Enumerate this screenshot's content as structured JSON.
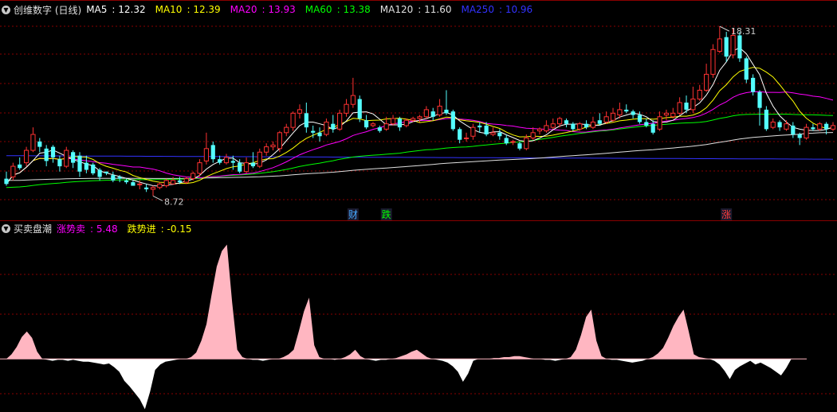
{
  "panel1": {
    "name": "创维数字 (日线)",
    "ma": [
      {
        "label": "MA5",
        "value": "12.32",
        "color": "#ffffff"
      },
      {
        "label": "MA10",
        "value": "12.39",
        "color": "#ffff00"
      },
      {
        "label": "MA20",
        "value": "13.93",
        "color": "#ff00ff"
      },
      {
        "label": "MA60",
        "value": "13.38",
        "color": "#00ff00"
      },
      {
        "label": "MA120",
        "value": "11.60",
        "color": "#e0e0e0"
      },
      {
        "label": "MA250",
        "value": "10.96",
        "color": "#3232ff"
      }
    ],
    "price_high_label": "18.31",
    "price_low_label": "8.72",
    "markers": [
      {
        "text": "财",
        "color": "#46aaff"
      },
      {
        "text": "跌",
        "color": "#00ff00"
      },
      {
        "text": "涨",
        "color": "#ff3c3c"
      }
    ]
  },
  "panel2": {
    "name": "买卖盘潮",
    "series": [
      {
        "label": "涨势卖",
        "value": "5.48",
        "color": "#ff00ff"
      },
      {
        "label": "跌势进",
        "value": "-0.15",
        "color": "#ffff00"
      }
    ]
  },
  "chart_data": {
    "type": "candlestick",
    "ylim": [
      8.2,
      18.9
    ],
    "candles": [
      [
        9.7,
        9.4,
        10.1,
        9.3
      ],
      [
        9.8,
        10.4,
        10.6,
        9.6
      ],
      [
        10.5,
        10.3,
        10.9,
        10.2
      ],
      [
        10.6,
        11.3,
        11.5,
        10.4
      ],
      [
        11.3,
        12.2,
        12.6,
        11.2
      ],
      [
        11.8,
        11.5,
        12.0,
        11.2
      ],
      [
        11.4,
        10.7,
        11.6,
        10.4
      ],
      [
        11.5,
        10.9,
        11.6,
        10.6
      ],
      [
        10.8,
        10.4,
        11.0,
        10.1
      ],
      [
        10.4,
        11.3,
        11.5,
        10.3
      ],
      [
        11.2,
        10.6,
        11.3,
        10.3
      ],
      [
        11.0,
        10.1,
        11.2,
        9.8
      ],
      [
        10.6,
        10.2,
        11.0,
        10.0
      ],
      [
        10.5,
        10.0,
        10.6,
        9.9
      ],
      [
        10.2,
        9.8,
        10.3,
        9.6
      ],
      [
        10.1,
        10.0,
        10.1,
        9.9
      ],
      [
        9.9,
        9.6,
        10.1,
        9.5
      ],
      [
        9.8,
        9.7,
        9.9,
        9.5
      ],
      [
        9.6,
        9.5,
        9.7,
        9.4
      ],
      [
        9.5,
        9.3,
        9.6,
        9.3
      ],
      [
        9.4,
        9.4,
        9.6,
        9.1
      ],
      [
        9.2,
        9.1,
        9.4,
        8.95
      ],
      [
        9.1,
        9.2,
        9.3,
        8.72
      ],
      [
        9.2,
        9.4,
        9.5,
        9.1
      ],
      [
        9.3,
        9.6,
        9.7,
        9.2
      ],
      [
        9.4,
        9.6,
        9.8,
        9.4
      ],
      [
        9.6,
        9.5,
        9.8,
        9.4
      ],
      [
        9.5,
        9.7,
        9.8,
        9.4
      ],
      [
        9.7,
        10.0,
        10.1,
        9.6
      ],
      [
        10.0,
        10.6,
        10.8,
        9.8
      ],
      [
        10.7,
        11.4,
        12.3,
        10.5
      ],
      [
        11.6,
        10.8,
        11.8,
        10.6
      ],
      [
        10.8,
        10.6,
        11.0,
        10.5
      ],
      [
        10.6,
        10.9,
        11.1,
        10.5
      ],
      [
        10.7,
        10.6,
        11.0,
        10.2
      ],
      [
        10.6,
        10.1,
        10.8,
        10.0
      ],
      [
        10.1,
        10.6,
        10.9,
        10.0
      ],
      [
        10.6,
        10.4,
        11.2,
        10.3
      ],
      [
        10.4,
        11.2,
        11.4,
        10.3
      ],
      [
        11.2,
        11.5,
        11.7,
        11.0
      ],
      [
        11.5,
        11.6,
        11.8,
        11.3
      ],
      [
        11.4,
        12.3,
        12.4,
        11.2
      ],
      [
        12.3,
        12.6,
        12.8,
        12.1
      ],
      [
        12.6,
        13.4,
        13.5,
        12.4
      ],
      [
        13.4,
        13.6,
        13.9,
        13.1
      ],
      [
        13.4,
        12.6,
        14.0,
        12.3
      ],
      [
        12.4,
        12.3,
        12.7,
        12.0
      ],
      [
        12.3,
        12.1,
        12.6,
        11.8
      ],
      [
        12.2,
        12.9,
        13.1,
        12.1
      ],
      [
        12.8,
        12.5,
        13.3,
        12.3
      ],
      [
        12.5,
        13.4,
        13.6,
        12.4
      ],
      [
        13.4,
        13.9,
        14.2,
        13.2
      ],
      [
        13.9,
        14.4,
        15.4,
        13.7
      ],
      [
        14.2,
        13.1,
        14.4,
        12.9
      ],
      [
        13.0,
        12.6,
        13.3,
        12.5
      ],
      [
        12.7,
        12.8,
        12.9,
        12.6
      ],
      [
        12.6,
        12.4,
        12.7,
        12.3
      ],
      [
        12.5,
        12.8,
        13.2,
        12.4
      ],
      [
        12.8,
        13.1,
        13.3,
        12.7
      ],
      [
        13.1,
        12.6,
        13.2,
        12.4
      ],
      [
        12.7,
        13.0,
        13.1,
        12.6
      ],
      [
        13.0,
        13.1,
        13.2,
        12.9
      ],
      [
        13.1,
        13.2,
        13.3,
        12.9
      ],
      [
        13.2,
        13.6,
        13.8,
        13.1
      ],
      [
        13.5,
        13.2,
        13.7,
        13.0
      ],
      [
        13.3,
        13.8,
        14.2,
        13.2
      ],
      [
        13.6,
        13.4,
        14.7,
        13.3
      ],
      [
        13.5,
        12.5,
        13.6,
        12.4
      ],
      [
        12.5,
        11.9,
        12.6,
        11.7
      ],
      [
        12.0,
        12.0,
        12.3,
        11.8
      ],
      [
        12.1,
        12.6,
        12.8,
        11.9
      ],
      [
        12.7,
        12.6,
        12.9,
        12.3
      ],
      [
        12.7,
        12.2,
        12.9,
        12.1
      ],
      [
        12.2,
        12.3,
        12.6,
        12.1
      ],
      [
        12.3,
        12.1,
        12.5,
        11.9
      ],
      [
        12.0,
        11.7,
        12.2,
        11.6
      ],
      [
        11.8,
        11.8,
        11.9,
        11.6
      ],
      [
        11.7,
        11.4,
        11.8,
        11.3
      ],
      [
        11.4,
        12.0,
        12.2,
        11.3
      ],
      [
        12.0,
        12.3,
        12.6,
        11.9
      ],
      [
        12.4,
        12.5,
        12.6,
        12.2
      ],
      [
        12.4,
        12.7,
        13.0,
        12.3
      ],
      [
        12.6,
        12.8,
        13.1,
        12.5
      ],
      [
        12.8,
        13.1,
        13.2,
        12.6
      ],
      [
        13.0,
        12.8,
        13.1,
        12.6
      ],
      [
        12.8,
        12.5,
        12.9,
        12.4
      ],
      [
        12.5,
        12.8,
        12.9,
        12.4
      ],
      [
        12.8,
        12.6,
        13.0,
        12.5
      ],
      [
        12.6,
        12.9,
        13.2,
        12.5
      ],
      [
        13.0,
        12.8,
        13.4,
        12.7
      ],
      [
        12.9,
        13.2,
        13.5,
        12.8
      ],
      [
        13.0,
        13.4,
        13.7,
        12.9
      ],
      [
        13.3,
        13.6,
        14.0,
        13.1
      ],
      [
        13.6,
        13.5,
        13.9,
        13.4
      ],
      [
        13.5,
        13.3,
        13.6,
        13.1
      ],
      [
        13.3,
        12.9,
        13.5,
        12.8
      ],
      [
        12.9,
        12.7,
        13.1,
        12.6
      ],
      [
        12.8,
        12.3,
        13.0,
        12.2
      ],
      [
        12.5,
        13.2,
        13.5,
        12.4
      ],
      [
        13.3,
        13.4,
        13.6,
        13.0
      ],
      [
        13.2,
        13.4,
        13.7,
        13.1
      ],
      [
        13.4,
        14.0,
        14.3,
        13.3
      ],
      [
        14.0,
        13.6,
        14.4,
        13.4
      ],
      [
        13.6,
        14.2,
        14.9,
        13.4
      ],
      [
        14.2,
        14.7,
        15.0,
        14.1
      ],
      [
        14.7,
        15.6,
        16.2,
        14.6
      ],
      [
        15.6,
        17.0,
        17.3,
        15.4
      ],
      [
        16.9,
        17.6,
        18.31,
        16.8
      ],
      [
        17.7,
        16.6,
        18.0,
        16.3
      ],
      [
        16.7,
        17.8,
        18.2,
        16.5
      ],
      [
        17.8,
        16.5,
        18.0,
        16.3
      ],
      [
        16.5,
        15.3,
        16.6,
        15.1
      ],
      [
        15.4,
        14.6,
        15.6,
        14.4
      ],
      [
        14.6,
        13.7,
        14.7,
        12.7
      ],
      [
        13.6,
        12.5,
        13.8,
        12.4
      ],
      [
        12.6,
        12.9,
        13.1,
        12.5
      ],
      [
        12.9,
        12.6,
        13.0,
        12.4
      ],
      [
        12.5,
        12.8,
        13.0,
        12.4
      ],
      [
        12.7,
        12.2,
        12.9,
        12.0
      ],
      [
        12.2,
        12.0,
        12.3,
        11.6
      ],
      [
        12.0,
        12.6,
        12.8,
        11.9
      ],
      [
        12.6,
        12.5,
        12.8,
        12.4
      ],
      [
        12.5,
        12.8,
        12.9,
        12.4
      ],
      [
        12.8,
        12.5,
        12.9,
        12.2
      ],
      [
        12.5,
        12.7,
        12.9,
        12.4
      ]
    ],
    "ma250": [
      11.0,
      10.8
    ],
    "ma120_start": 9.6,
    "osc_ylim": [
      -5.8,
      13.5
    ],
    "osc": [
      0,
      0.5,
      1.3,
      2.4,
      3.0,
      2.3,
      0.8,
      0,
      -0.1,
      -0.2,
      -0.1,
      -0.1,
      -0.2,
      -0.1,
      -0.2,
      -0.3,
      -0.3,
      -0.4,
      -0.5,
      -0.6,
      -0.5,
      -0.9,
      -1.4,
      -2.4,
      -3.0,
      -3.7,
      -4.4,
      -5.5,
      -3.6,
      -1.2,
      -0.6,
      -0.3,
      -0.2,
      -0.1,
      0,
      0,
      0.2,
      0.7,
      2.0,
      3.8,
      7.0,
      10.1,
      11.8,
      12.5,
      6.2,
      1.0,
      0.2,
      0,
      -0.1,
      -0.1,
      -0.2,
      -0.1,
      0,
      0,
      0.2,
      0.5,
      1.0,
      3.0,
      5.2,
      6.7,
      1.5,
      0.2,
      0,
      0,
      -0.1,
      0,
      0.2,
      0.5,
      1.0,
      0.3,
      0,
      -0.1,
      -0.2,
      -0.1,
      -0.1,
      0,
      0.1,
      0.3,
      0.5,
      0.8,
      1.0,
      0.6,
      0.2,
      0,
      -0.1,
      -0.2,
      -0.4,
      -0.8,
      -1.4,
      -2.5,
      -1.6,
      -0.2,
      0,
      0,
      0,
      0.1,
      0.1,
      0.2,
      0.2,
      0.3,
      0.3,
      0.2,
      0.1,
      0,
      0,
      -0.1,
      -0.1,
      -0.2,
      -0.1,
      0,
      0.2,
      1.0,
      2.6,
      4.6,
      5.4,
      2.0,
      0.3,
      0,
      -0.1,
      -0.1,
      -0.2,
      -0.3,
      -0.4,
      -0.3,
      -0.2,
      0,
      0.2,
      0.6,
      1.2,
      2.3,
      3.6,
      4.6,
      5.4,
      3.0,
      0.5,
      0.2,
      0.1,
      0,
      -0.2,
      -0.6,
      -1.3,
      -2.2,
      -1.2,
      -0.8,
      -0.5,
      -0.2,
      -0.6,
      -0.4,
      -0.7,
      -1.0,
      -1.4,
      -1.8,
      -1.0,
      0,
      0,
      0,
      0
    ]
  }
}
